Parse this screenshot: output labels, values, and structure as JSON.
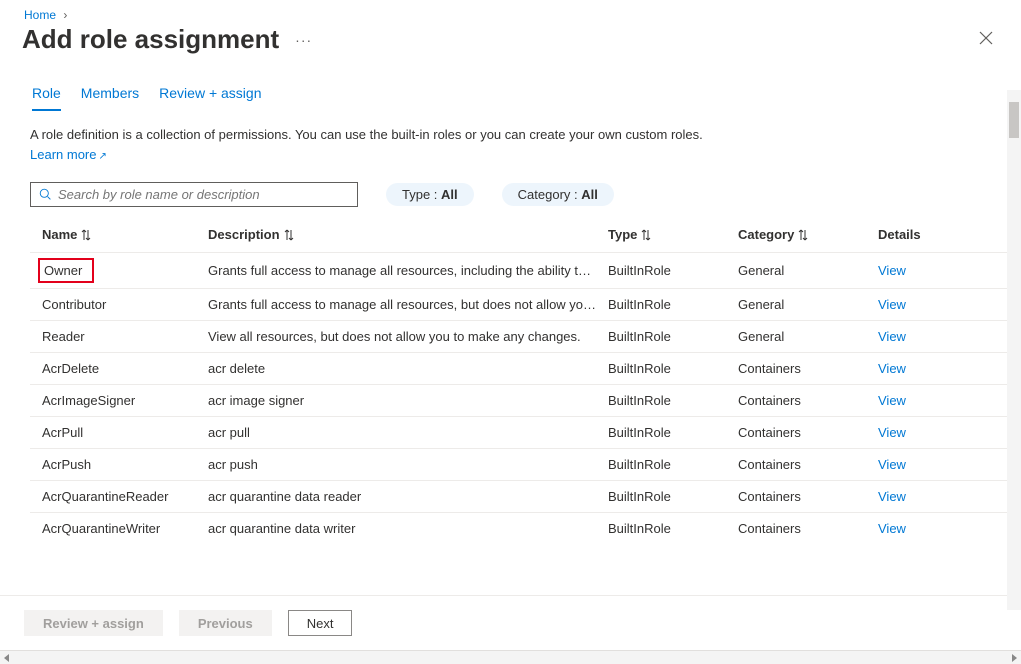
{
  "breadcrumb": {
    "home": "Home"
  },
  "page": {
    "title": "Add role assignment"
  },
  "tabs": [
    {
      "label": "Role",
      "active": true
    },
    {
      "label": "Members",
      "active": false
    },
    {
      "label": "Review + assign",
      "active": false
    }
  ],
  "intro": {
    "text": "A role definition is a collection of permissions. You can use the built-in roles or you can create your own custom roles. ",
    "learn_more": "Learn more"
  },
  "search": {
    "placeholder": "Search by role name or description"
  },
  "filters": {
    "type_label": "Type : ",
    "type_value": "All",
    "category_label": "Category : ",
    "category_value": "All"
  },
  "columns": {
    "name": "Name",
    "description": "Description",
    "type": "Type",
    "category": "Category",
    "details": "Details"
  },
  "rows": [
    {
      "name": "Owner",
      "highlighted": true,
      "description": "Grants full access to manage all resources, including the ability to a...",
      "type": "BuiltInRole",
      "category": "General",
      "details": "View"
    },
    {
      "name": "Contributor",
      "highlighted": false,
      "description": "Grants full access to manage all resources, but does not allow you ...",
      "type": "BuiltInRole",
      "category": "General",
      "details": "View"
    },
    {
      "name": "Reader",
      "highlighted": false,
      "description": "View all resources, but does not allow you to make any changes.",
      "type": "BuiltInRole",
      "category": "General",
      "details": "View"
    },
    {
      "name": "AcrDelete",
      "highlighted": false,
      "description": "acr delete",
      "type": "BuiltInRole",
      "category": "Containers",
      "details": "View"
    },
    {
      "name": "AcrImageSigner",
      "highlighted": false,
      "description": "acr image signer",
      "type": "BuiltInRole",
      "category": "Containers",
      "details": "View"
    },
    {
      "name": "AcrPull",
      "highlighted": false,
      "description": "acr pull",
      "type": "BuiltInRole",
      "category": "Containers",
      "details": "View"
    },
    {
      "name": "AcrPush",
      "highlighted": false,
      "description": "acr push",
      "type": "BuiltInRole",
      "category": "Containers",
      "details": "View"
    },
    {
      "name": "AcrQuarantineReader",
      "highlighted": false,
      "description": "acr quarantine data reader",
      "type": "BuiltInRole",
      "category": "Containers",
      "details": "View"
    },
    {
      "name": "AcrQuarantineWriter",
      "highlighted": false,
      "description": "acr quarantine data writer",
      "type": "BuiltInRole",
      "category": "Containers",
      "details": "View"
    }
  ],
  "footer": {
    "review": "Review + assign",
    "previous": "Previous",
    "next": "Next"
  }
}
